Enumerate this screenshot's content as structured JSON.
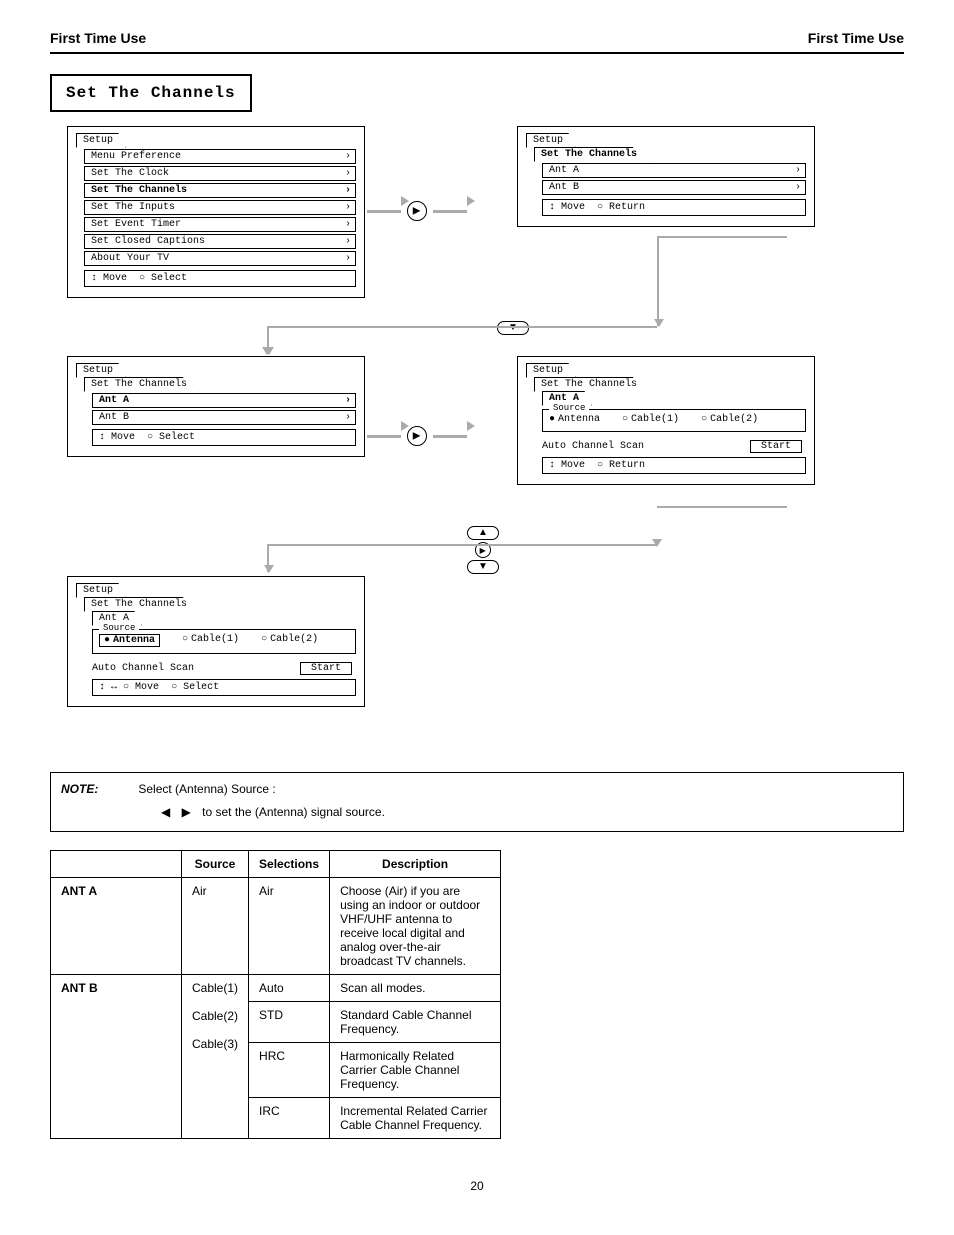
{
  "header": {
    "left": "First Time Use",
    "right": "First Time Use"
  },
  "section_title": "Set The Channels",
  "menus": {
    "setup_tab": "Setup",
    "set_channels_tab": "Set The Channels",
    "ant_a_tab": "Ant A",
    "m1_items": [
      "Menu Preference",
      "Set The Clock",
      "Set The Channels",
      "Set The Inputs",
      "Set Event Timer",
      "Set Closed Captions",
      "About Your TV"
    ],
    "m2_items": [
      "Ant A",
      "Ant B"
    ],
    "source_legend": "Source",
    "radio_antenna": "Antenna",
    "radio_cable1": "Cable(1)",
    "radio_cable2": "Cable(2)",
    "auto_scan": "Auto Channel Scan",
    "start_btn": "Start",
    "foot_move": "Move",
    "foot_select": "Select",
    "foot_return": "Return"
  },
  "note": {
    "label": "NOTE:",
    "text": "Select (Antenna) Source :",
    "sub": "to set the (Antenna) signal source."
  },
  "table": {
    "headers": [
      "",
      "Source",
      "Selections",
      "Description"
    ],
    "rows": [
      {
        "label": "ANT A",
        "src": "Air",
        "sel_head": "Air",
        "sel_text": "Choose (Air) if you are using an indoor or outdoor VHF/UHF antenna to receive local digital and analog over-the-air broadcast TV channels."
      },
      {
        "label": "ANT B",
        "src_span": "Cable(1)\n\nCable(2)\n\nCable(3)",
        "rows": [
          {
            "sel": "Auto",
            "desc": "Scan all modes."
          },
          {
            "sel": "STD",
            "desc": "Standard Cable Channel Frequency."
          },
          {
            "sel": "HRC",
            "desc": "Harmonically Related Carrier Cable Channel Frequency."
          },
          {
            "sel": "IRC",
            "desc": "Incremental Related Carrier Cable Channel Frequency."
          }
        ]
      }
    ]
  },
  "page_number": "20"
}
